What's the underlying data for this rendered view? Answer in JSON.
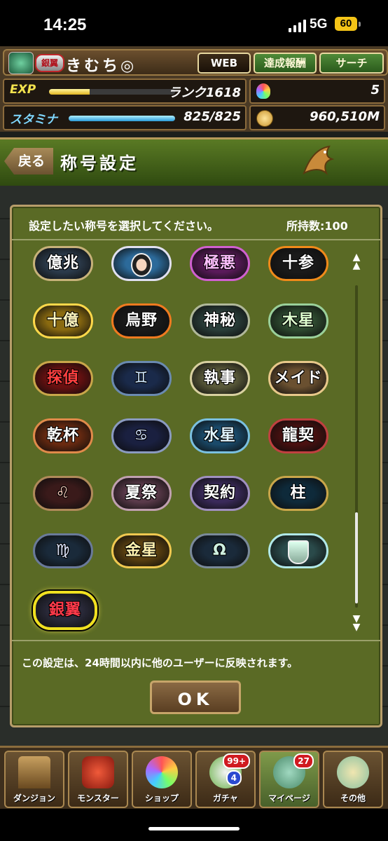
{
  "status_bar": {
    "time": "14:25",
    "network": "5G",
    "battery": "60"
  },
  "user": {
    "badge": "銀翼",
    "name": "きむち◎"
  },
  "top_buttons": {
    "web": "WEB",
    "achievements": "達成報酬",
    "search": "サーチ"
  },
  "stats": {
    "exp_label": "EXP",
    "rank": "ランク1618",
    "exp_progress": 0.32,
    "stamina_label": "スタミナ",
    "stamina": "825/825",
    "stamina_progress": 1.0,
    "stones": "5",
    "coins": "960,510M"
  },
  "header": {
    "back": "戻る",
    "title": "称号設定"
  },
  "panel": {
    "prompt": "設定したい称号を選択してください。",
    "count": "所持数:100",
    "note": "この設定は、24時間以内に他のユーザーに反映されます。",
    "ok": "OK"
  },
  "title_badges": [
    {
      "text": "億兆",
      "bg": "#2b3a4a",
      "border": "#c7b27a",
      "color": "#ffffff"
    },
    {
      "text": "",
      "bg": "#2c6a9a",
      "border": "#e0e0f0",
      "color": "#ffffff",
      "icon": "character-portrait-icon"
    },
    {
      "text": "極悪",
      "bg": "#5a1a5a",
      "border": "#d060d0",
      "color": "#ffc0ff"
    },
    {
      "text": "十参",
      "bg": "#1a1a1a",
      "border": "#f08a1a",
      "color": "#ffffff"
    },
    {
      "text": "十億",
      "bg": "#8a6a10",
      "border": "#ffd84a",
      "color": "#fff6c0"
    },
    {
      "text": "烏野",
      "bg": "#1a1a1a",
      "border": "#f07a20",
      "color": "#ffffff"
    },
    {
      "text": "神秘",
      "bg": "#2a3e3a",
      "border": "#b0b89a",
      "color": "#ffffff"
    },
    {
      "text": "木星",
      "bg": "#2e4a30",
      "border": "#9ad09a",
      "color": "#e0ffd0"
    },
    {
      "text": "探偵",
      "bg": "#6a1010",
      "border": "#c9a64a",
      "color": "#ff4040"
    },
    {
      "text": "♊",
      "bg": "#1a2a4a",
      "border": "#6a8ab0",
      "color": "#d0e8ff"
    },
    {
      "text": "執事",
      "bg": "#5a5a3a",
      "border": "#d8d0a0",
      "color": "#ffffff"
    },
    {
      "text": "メイド",
      "bg": "#6a5030",
      "border": "#e8c88a",
      "color": "#ffffff"
    },
    {
      "text": "乾杯",
      "bg": "#6a2a10",
      "border": "#e08a4a",
      "color": "#ffffff"
    },
    {
      "text": "♋",
      "bg": "#1a2040",
      "border": "#8a9ac0",
      "color": "#d0e0ff"
    },
    {
      "text": "水星",
      "bg": "#1a4a6a",
      "border": "#7ac0e0",
      "color": "#e0f4ff"
    },
    {
      "text": "龍契",
      "bg": "#4a1010",
      "border": "#c04040",
      "color": "#ffffff"
    },
    {
      "text": "♌",
      "bg": "#3a1a1a",
      "border": "#b08a5a",
      "color": "#ffd0c0"
    },
    {
      "text": "夏祭",
      "bg": "#5a3a4a",
      "border": "#c0a0b0",
      "color": "#ffffff"
    },
    {
      "text": "契約",
      "bg": "#3a2a5a",
      "border": "#a090c0",
      "color": "#ffffff"
    },
    {
      "text": "柱",
      "bg": "#0e2a3a",
      "border": "#c9a64a",
      "color": "#ffffff"
    },
    {
      "text": "♍",
      "bg": "#1a2a3a",
      "border": "#6a7a9a",
      "color": "#e0e8ff"
    },
    {
      "text": "金星",
      "bg": "#5a4010",
      "border": "#f0c850",
      "color": "#fff2b0"
    },
    {
      "text": "Ω",
      "bg": "#1a2a3a",
      "border": "#7a8a9a",
      "color": "#d0f0e0"
    },
    {
      "text": "",
      "bg": "#2a4a4a",
      "border": "#b0e8e8",
      "color": "#ffffff",
      "icon": "shield-crest-icon"
    },
    {
      "text": "銀翼",
      "bg": "#2a2a3a",
      "border": "#f0e020",
      "color": "#ff3a4a",
      "selected": true
    }
  ],
  "bottom_nav": [
    {
      "label": "ダンジョン",
      "icon": "dungeon-gate-icon"
    },
    {
      "label": "モンスター",
      "icon": "red-dragon-icon"
    },
    {
      "label": "ショップ",
      "icon": "magic-stone-icon"
    },
    {
      "label": "ガチャ",
      "icon": "egg-machine-icon",
      "badge": "99+",
      "badge2": "4"
    },
    {
      "label": "マイページ",
      "icon": "mypage-icon",
      "badge": "27",
      "active": true
    },
    {
      "label": "その他",
      "icon": "question-icon"
    }
  ]
}
